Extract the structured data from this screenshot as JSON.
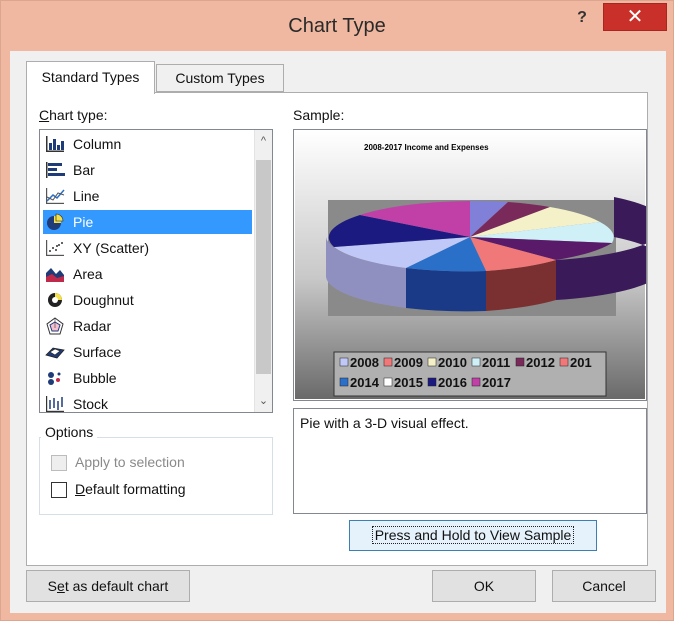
{
  "dialog": {
    "title": "Chart Type",
    "help_glyph": "?",
    "close_glyph": "✕"
  },
  "tabs": [
    {
      "label": "Standard Types"
    },
    {
      "label": "Custom Types"
    }
  ],
  "chart_type_label": {
    "before": "",
    "underlined": "C",
    "after": "hart type:"
  },
  "chart_types": [
    {
      "label": "Column",
      "icon": "column-chart-icon"
    },
    {
      "label": "Bar",
      "icon": "bar-chart-icon"
    },
    {
      "label": "Line",
      "icon": "line-chart-icon"
    },
    {
      "label": "Pie",
      "icon": "pie-chart-icon",
      "selected": true
    },
    {
      "label": "XY (Scatter)",
      "icon": "scatter-chart-icon"
    },
    {
      "label": "Area",
      "icon": "area-chart-icon"
    },
    {
      "label": "Doughnut",
      "icon": "doughnut-chart-icon"
    },
    {
      "label": "Radar",
      "icon": "radar-chart-icon"
    },
    {
      "label": "Surface",
      "icon": "surface-chart-icon"
    },
    {
      "label": "Bubble",
      "icon": "bubble-chart-icon"
    },
    {
      "label": "Stock",
      "icon": "stock-chart-icon"
    }
  ],
  "options": {
    "legend": "Options",
    "apply_to_selection": {
      "label": "Apply to selection",
      "checked": false,
      "disabled": true
    },
    "default_formatting": {
      "before": "",
      "underlined": "D",
      "after": "efault formatting",
      "checked": false
    }
  },
  "sample": {
    "label": "Sample:",
    "chart_title": "2008-2017 Income and Expenses",
    "legend_row1": [
      "2008",
      "2009",
      "2010",
      "2011",
      "2012",
      "201"
    ],
    "legend_row2": [
      "2014",
      "2015",
      "2016",
      "2017"
    ]
  },
  "description": "Pie with a 3-D visual effect.",
  "buttons": {
    "press_hold": "Press and Hold to View Sample",
    "set_default": {
      "before": "S",
      "underlined": "e",
      "after": "t as default chart"
    },
    "ok": "OK",
    "cancel": "Cancel"
  },
  "colors": {
    "selection": "#3399ff",
    "close": "#c9302a",
    "frame": "#f0b8a0",
    "slices": [
      "#8080d8",
      "#7a2a5a",
      "#f4f0c8",
      "#d0f0f8",
      "#5a1a6a",
      "#f07878",
      "#2a70c8",
      "#c0c8f8",
      "#1a1a80",
      "#c040a8"
    ]
  }
}
